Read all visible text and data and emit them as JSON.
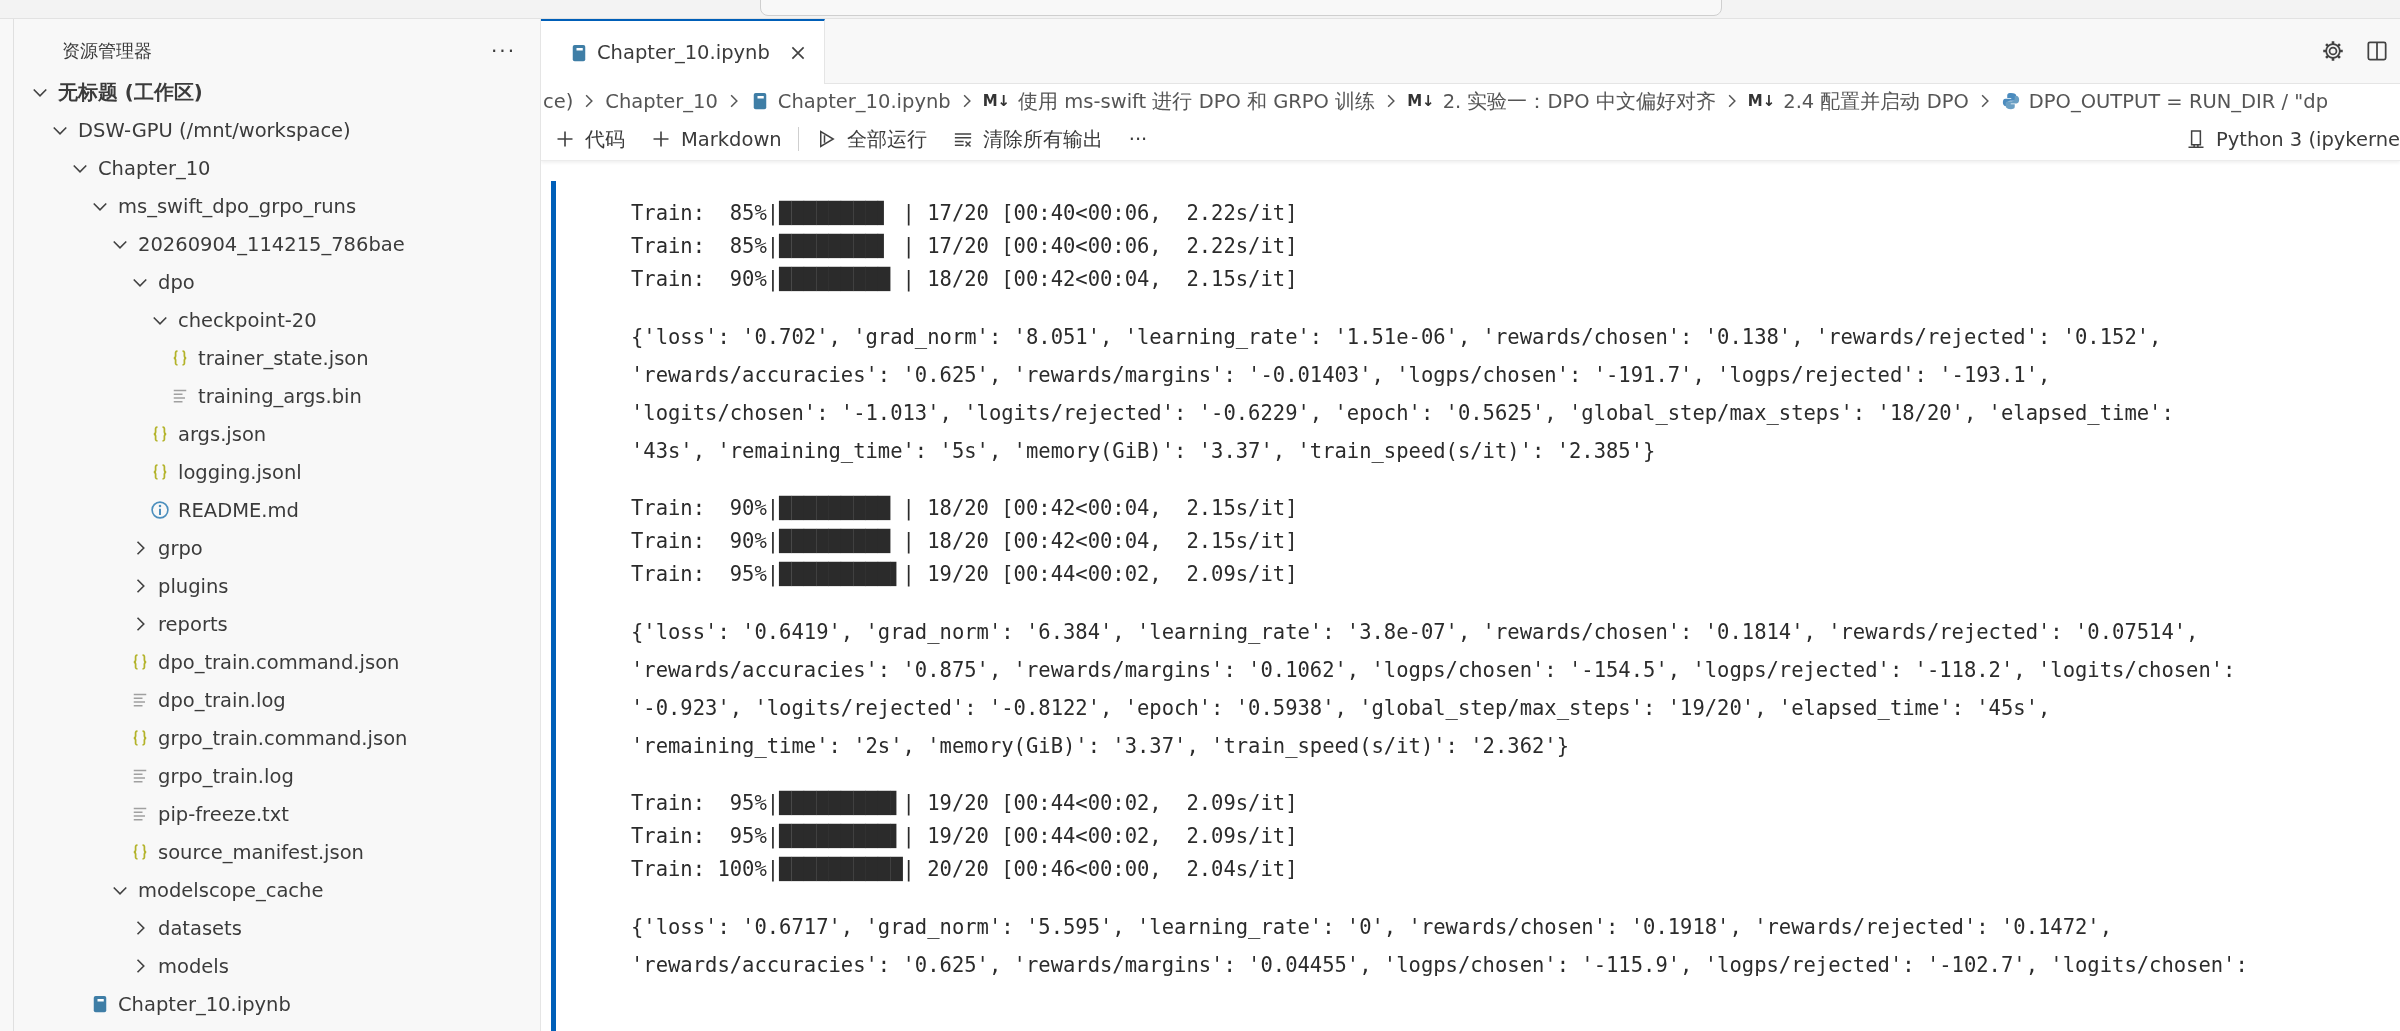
{
  "sidebar": {
    "title": "资源管理器",
    "more": "···",
    "tree": [
      {
        "label": "无标题 (工作区)",
        "kind": "root",
        "expanded": true,
        "children": [
          {
            "label": "DSW-GPU (/mnt/workspace)",
            "kind": "folder",
            "expanded": true,
            "children": [
              {
                "label": "Chapter_10",
                "kind": "folder",
                "expanded": true,
                "children": [
                  {
                    "label": "ms_swift_dpo_grpo_runs",
                    "kind": "folder",
                    "expanded": true,
                    "children": [
                      {
                        "label": "20260904_114215_786bae",
                        "kind": "folder",
                        "expanded": true,
                        "children": [
                          {
                            "label": "dpo",
                            "kind": "folder",
                            "expanded": true,
                            "children": [
                              {
                                "label": "checkpoint-20",
                                "kind": "folder",
                                "expanded": true,
                                "children": [
                                  {
                                    "label": "trainer_state.json",
                                    "kind": "json"
                                  },
                                  {
                                    "label": "training_args.bin",
                                    "kind": "text"
                                  }
                                ]
                              },
                              {
                                "label": "args.json",
                                "kind": "json"
                              },
                              {
                                "label": "logging.jsonl",
                                "kind": "json"
                              },
                              {
                                "label": "README.md",
                                "kind": "info"
                              }
                            ]
                          },
                          {
                            "label": "grpo",
                            "kind": "folder",
                            "expanded": false
                          },
                          {
                            "label": "plugins",
                            "kind": "folder",
                            "expanded": false
                          },
                          {
                            "label": "reports",
                            "kind": "folder",
                            "expanded": false
                          },
                          {
                            "label": "dpo_train.command.json",
                            "kind": "json"
                          },
                          {
                            "label": "dpo_train.log",
                            "kind": "text"
                          },
                          {
                            "label": "grpo_train.command.json",
                            "kind": "json"
                          },
                          {
                            "label": "grpo_train.log",
                            "kind": "text"
                          },
                          {
                            "label": "pip-freeze.txt",
                            "kind": "text"
                          },
                          {
                            "label": "source_manifest.json",
                            "kind": "json"
                          }
                        ]
                      },
                      {
                        "label": "modelscope_cache",
                        "kind": "folder",
                        "expanded": true,
                        "children": [
                          {
                            "label": "datasets",
                            "kind": "folder",
                            "expanded": false
                          },
                          {
                            "label": "models",
                            "kind": "folder",
                            "expanded": false
                          }
                        ]
                      }
                    ]
                  },
                  {
                    "label": "Chapter_10.ipynb",
                    "kind": "notebook"
                  }
                ]
              }
            ]
          }
        ]
      }
    ]
  },
  "tabs": [
    {
      "label": "Chapter_10.ipynb",
      "selected": true
    }
  ],
  "breadcrumb": [
    {
      "label": "ce)",
      "kind": "plain"
    },
    {
      "label": "Chapter_10",
      "kind": "plain"
    },
    {
      "label": "Chapter_10.ipynb",
      "kind": "notebook"
    },
    {
      "label": "使用 ms-swift 进行 DPO 和 GRPO 训练",
      "kind": "markdown",
      "icon": "M↓"
    },
    {
      "label": "2. 实验一：DPO 中文偏好对齐",
      "kind": "markdown",
      "icon": "M↓"
    },
    {
      "label": "2.4 配置并启动 DPO",
      "kind": "markdown",
      "icon": "M↓"
    },
    {
      "label": "DPO_OUTPUT = RUN_DIR / \"dp",
      "kind": "python"
    }
  ],
  "toolbar": [
    {
      "label": "代码",
      "kind": "add"
    },
    {
      "label": "Markdown",
      "kind": "add"
    },
    {
      "label": "全部运行",
      "kind": "run"
    },
    {
      "label": "清除所有输出",
      "kind": "clear"
    },
    {
      "label": "···",
      "kind": "more"
    }
  ],
  "kernel": "Python 3 (ipykerne",
  "output": [
    {
      "kind": "progress",
      "lines": [
        "Train:  85%|████████▌ | 17/20 [00:40<00:06,  2.22s/it]",
        "Train:  85%|████████▌ | 17/20 [00:40<00:06,  2.22s/it]",
        "Train:  90%|█████████ | 18/20 [00:42<00:04,  2.15s/it]"
      ]
    },
    {
      "kind": "dict",
      "lines": [
        "{'loss': '0.702', 'grad_norm': '8.051', 'learning_rate': '1.51e-06', 'rewards/chosen': '0.138', 'rewards/rejected': '0.152',",
        "'rewards/accuracies': '0.625', 'rewards/margins': '-0.01403', 'logps/chosen': '-191.7', 'logps/rejected': '-193.1',",
        "'logits/chosen': '-1.013', 'logits/rejected': '-0.6229', 'epoch': '0.5625', 'global_step/max_steps': '18/20', 'elapsed_time':",
        "'43s', 'remaining_time': '5s', 'memory(GiB)': '3.37', 'train_speed(s/it)': '2.385'}"
      ]
    },
    {
      "kind": "progress",
      "lines": [
        "Train:  90%|█████████ | 18/20 [00:42<00:04,  2.15s/it]",
        "Train:  90%|█████████ | 18/20 [00:42<00:04,  2.15s/it]",
        "Train:  95%|█████████▌| 19/20 [00:44<00:02,  2.09s/it]"
      ]
    },
    {
      "kind": "dict",
      "lines": [
        "{'loss': '0.6419', 'grad_norm': '6.384', 'learning_rate': '3.8e-07', 'rewards/chosen': '0.1814', 'rewards/rejected': '0.07514',",
        "'rewards/accuracies': '0.875', 'rewards/margins': '0.1062', 'logps/chosen': '-154.5', 'logps/rejected': '-118.2', 'logits/chosen':",
        "'-0.923', 'logits/rejected': '-0.8122', 'epoch': '0.5938', 'global_step/max_steps': '19/20', 'elapsed_time': '45s',",
        "'remaining_time': '2s', 'memory(GiB)': '3.37', 'train_speed(s/it)': '2.362'}"
      ]
    },
    {
      "kind": "progress",
      "lines": [
        "Train:  95%|█████████▌| 19/20 [00:44<00:02,  2.09s/it]",
        "Train:  95%|█████████▌| 19/20 [00:44<00:02,  2.09s/it]",
        "Train: 100%|██████████| 20/20 [00:46<00:00,  2.04s/it]"
      ]
    },
    {
      "kind": "dict",
      "lines": [
        "{'loss': '0.6717', 'grad_norm': '5.595', 'learning_rate': '0', 'rewards/chosen': '0.1918', 'rewards/rejected': '0.1472',",
        "'rewards/accuracies': '0.625', 'rewards/margins': '0.04455', 'logps/chosen': '-115.9', 'logps/rejected': '-102.7', 'logits/chosen':"
      ]
    }
  ]
}
